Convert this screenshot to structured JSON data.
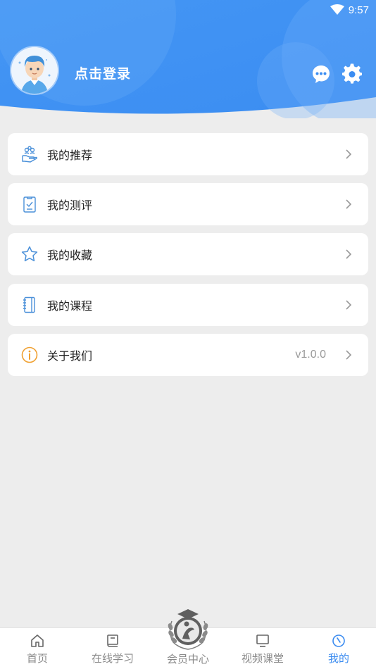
{
  "status_bar": {
    "time": "9:57"
  },
  "header": {
    "login_text": "点击登录",
    "colors": {
      "primary": "#3b8df2",
      "light": "#5aa2f6"
    }
  },
  "menu": {
    "items": [
      {
        "label": "我的推荐",
        "icon": "hand-users-icon",
        "value": ""
      },
      {
        "label": "我的测评",
        "icon": "clipboard-check-icon",
        "value": ""
      },
      {
        "label": "我的收藏",
        "icon": "star-icon",
        "value": ""
      },
      {
        "label": "我的课程",
        "icon": "notebook-icon",
        "value": ""
      },
      {
        "label": "关于我们",
        "icon": "info-circle-icon",
        "value": "v1.0.0"
      }
    ]
  },
  "tabbar": {
    "tabs": [
      {
        "label": "首页",
        "icon": "home-icon"
      },
      {
        "label": "在线学习",
        "icon": "book-icon"
      },
      {
        "label": "会员中心",
        "icon": "emblem-icon"
      },
      {
        "label": "视频课堂",
        "icon": "monitor-icon"
      },
      {
        "label": "我的",
        "icon": "compass-icon",
        "active": true
      }
    ],
    "active_color": "#3a8bf0"
  }
}
